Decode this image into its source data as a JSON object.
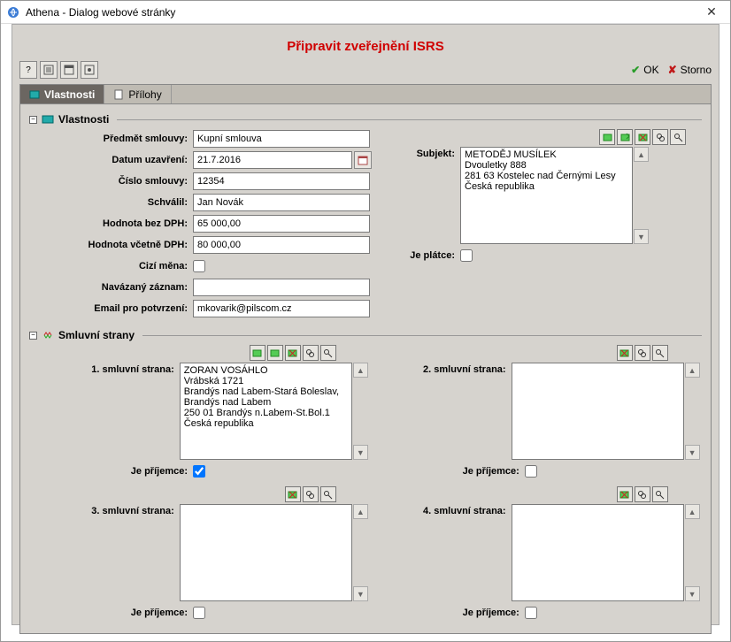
{
  "window": {
    "title": "Athena - Dialog webové stránky"
  },
  "header": {
    "title": "Připravit zveřejnění ISRS"
  },
  "toolbar": {
    "ok": "OK",
    "storno": "Storno"
  },
  "tabs": {
    "vlastnosti": "Vlastnosti",
    "prilohy": "Přílohy"
  },
  "groups": {
    "vlastnosti": "Vlastnosti",
    "strany": "Smluvní strany"
  },
  "labels": {
    "predmet": "Předmět smlouvy:",
    "datum": "Datum uzavření:",
    "cislo": "Číslo smlouvy:",
    "schvalil": "Schválil:",
    "bezdph": "Hodnota bez DPH:",
    "vcdph": "Hodnota včetně DPH:",
    "mena": "Cizí měna:",
    "navaz": "Navázaný záznam:",
    "email": "Email pro potvrzení:",
    "subjekt": "Subjekt:",
    "jeplatce": "Je plátce:",
    "jeprijemce": "Je příjemce:",
    "strana1": "1. smluvní strana:",
    "strana2": "2. smluvní strana:",
    "strana3": "3. smluvní strana:",
    "strana4": "4. smluvní strana:"
  },
  "values": {
    "predmet": "Kupní smlouva",
    "datum": "21.7.2016",
    "cislo": "12354",
    "schvalil": "Jan Novák",
    "bezdph": "65 000,00",
    "vcdph": "80 000,00",
    "navaz": "",
    "email": "mkovarik@pilscom.cz",
    "subjekt": "METODĚJ MUSÍLEK\nDvouletky 888\n281 63 Kostelec nad Černými Lesy\nČeská republika",
    "strana1": "ZORAN VOSÁHLO\nVrábská 1721\nBrandýs nad Labem-Stará Boleslav,\nBrandýs nad Labem\n250 01 Brandýs n.Labem-St.Bol.1\nČeská republika",
    "strana2": "",
    "strana3": "",
    "strana4": ""
  },
  "checks": {
    "mena": false,
    "jeplatce": false,
    "prijemce1": true,
    "prijemce2": false,
    "prijemce3": false,
    "prijemce4": false
  }
}
